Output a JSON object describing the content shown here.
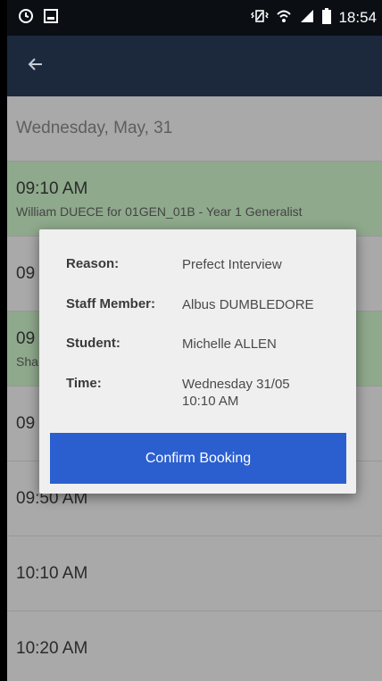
{
  "status_bar": {
    "time": "18:54",
    "icons": [
      "alarm-icon",
      "screenshot-icon",
      "vibrate-icon",
      "wifi-icon",
      "signal-icon",
      "battery-icon"
    ]
  },
  "app_bar": {
    "back_icon": "arrow-back-icon"
  },
  "list": {
    "date_header": "Wednesday, May, 31",
    "slots": [
      {
        "time": "09:10 AM",
        "desc": "William DUECE for 01GEN_01B - Year 1 Generalist",
        "booked": true
      },
      {
        "time": "09",
        "desc": "",
        "booked": false
      },
      {
        "time": "09",
        "desc": "Sha",
        "booked": true
      },
      {
        "time": "09",
        "desc": "",
        "booked": false
      },
      {
        "time": "09:50 AM",
        "desc": "",
        "booked": false
      },
      {
        "time": "10:10 AM",
        "desc": "",
        "booked": false
      },
      {
        "time": "10:20 AM",
        "desc": "",
        "booked": false
      }
    ]
  },
  "dialog": {
    "reason_label": "Reason:",
    "reason_value": "Prefect Interview",
    "staff_label": "Staff Member:",
    "staff_value": "Albus DUMBLEDORE",
    "student_label": "Student:",
    "student_value": "Michelle ALLEN",
    "time_label": "Time:",
    "time_value_line1": "Wednesday 31/05",
    "time_value_line2": "10:10 AM",
    "confirm_label": "Confirm Booking"
  },
  "colors": {
    "app_bar": "#1c293d",
    "booked_row": "#8fa98c",
    "confirm_button": "#2b5fcf"
  }
}
